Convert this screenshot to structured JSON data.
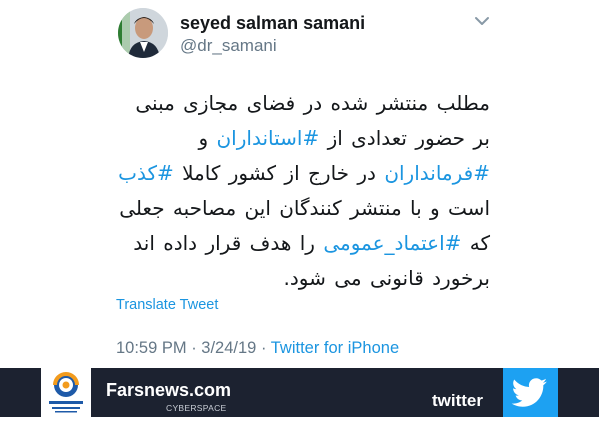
{
  "tweet": {
    "author_name": "seyed salman samani",
    "author_handle": "@dr_samani",
    "text": {
      "p1": "مطلب منتشر شده در فضای مجازی مبنی بر حضور تعدادی از ",
      "tag1": "#استانداران",
      "p2": " و ",
      "tag2": "#فرمانداران",
      "p3": " در خارج از کشور کاملا ",
      "tag3": "#کذب",
      "p4": " است و با منتشر کنندگان این مصاحبه جعلی که ",
      "tag4": "#اعتماد_عمومی",
      "p5": " را هدف قرار داده اند برخورد قانونی می شود."
    },
    "translate_label": "Translate Tweet",
    "time": "10:59 PM",
    "separator": " · ",
    "date": "3/24/19",
    "source": "Twitter for iPhone",
    "icons": {
      "avatar": "profile-photo",
      "caret": "chevron-down-icon"
    }
  },
  "footer": {
    "site": "Farsnews.com",
    "section": "CYBERSPACE",
    "platform": "twitter",
    "icons": {
      "brand_logo": "fars-news-agency-logo",
      "platform_logo": "twitter-bird-icon"
    },
    "colors": {
      "bar": "#1c2230",
      "twitter_blue": "#1da1f2",
      "link": "#1b95e0"
    }
  }
}
